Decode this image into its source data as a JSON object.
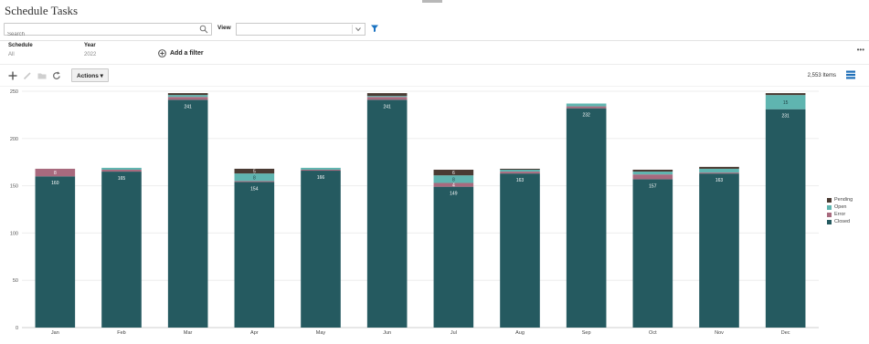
{
  "page": {
    "title": "Schedule Tasks"
  },
  "search": {
    "placeholder": "Search",
    "value": ""
  },
  "view": {
    "label": "View",
    "value": ""
  },
  "filters": [
    {
      "label": "Schedule",
      "value": "All"
    },
    {
      "label": "Year",
      "value": "2022"
    }
  ],
  "add_filter_label": "Add a filter",
  "more_label": "•••",
  "toolbar": {
    "actions_label": "Actions ▾",
    "items_count": "2,553 Items"
  },
  "icons": {
    "add": "plus-icon",
    "edit": "pencil-icon",
    "folder": "folder-icon",
    "refresh": "refresh-icon",
    "search": "search-icon",
    "filter": "filter-icon",
    "chart": "bar-chart-icon"
  },
  "chart_data": {
    "type": "bar",
    "stacked": true,
    "categories": [
      "Jan",
      "Feb",
      "Mar",
      "Apr",
      "May",
      "Jun",
      "Jul",
      "Aug",
      "Sep",
      "Oct",
      "Nov",
      "Dec"
    ],
    "ylim": [
      0,
      250
    ],
    "yticks": [
      0,
      50,
      100,
      150,
      200,
      250
    ],
    "grid": true,
    "legend_position": "right",
    "series": [
      {
        "name": "Closed",
        "color": "#255a60",
        "values": [
          160,
          165,
          241,
          154,
          166,
          241,
          149,
          163,
          232,
          157,
          163,
          231
        ]
      },
      {
        "name": "Error",
        "color": "#a86a7e",
        "values": [
          8,
          2,
          3,
          1,
          1,
          3,
          4,
          2,
          2,
          5,
          1,
          0
        ]
      },
      {
        "name": "Open",
        "color": "#5fb5b0",
        "values": [
          0,
          2,
          2,
          8,
          2,
          1,
          8,
          2,
          3,
          3,
          4,
          15
        ]
      },
      {
        "name": "Pending",
        "color": "#4a3b33",
        "values": [
          0,
          0,
          2,
          5,
          0,
          3,
          6,
          1,
          0,
          2,
          2,
          2
        ]
      }
    ],
    "data_labels": [
      {
        "category": "Jan",
        "series": "Closed",
        "text": "160"
      },
      {
        "category": "Jan",
        "series": "Error",
        "text": "8"
      },
      {
        "category": "Feb",
        "series": "Closed",
        "text": "165"
      },
      {
        "category": "Mar",
        "series": "Closed",
        "text": "241"
      },
      {
        "category": "Apr",
        "series": "Closed",
        "text": "154"
      },
      {
        "category": "Apr",
        "series": "Open",
        "text": "8"
      },
      {
        "category": "Apr",
        "series": "Pending",
        "text": "5"
      },
      {
        "category": "May",
        "series": "Closed",
        "text": "166"
      },
      {
        "category": "Jun",
        "series": "Closed",
        "text": "241"
      },
      {
        "category": "Jul",
        "series": "Closed",
        "text": "149"
      },
      {
        "category": "Jul",
        "series": "Error",
        "text": "4"
      },
      {
        "category": "Jul",
        "series": "Open",
        "text": "8"
      },
      {
        "category": "Jul",
        "series": "Pending",
        "text": "6"
      },
      {
        "category": "Aug",
        "series": "Closed",
        "text": "163"
      },
      {
        "category": "Sep",
        "series": "Closed",
        "text": "232"
      },
      {
        "category": "Oct",
        "series": "Closed",
        "text": "157"
      },
      {
        "category": "Nov",
        "series": "Closed",
        "text": "163"
      },
      {
        "category": "Dec",
        "series": "Closed",
        "text": "231"
      },
      {
        "category": "Dec",
        "series": "Open",
        "text": "15"
      }
    ],
    "legend_order": [
      "Pending",
      "Open",
      "Error",
      "Closed"
    ]
  }
}
